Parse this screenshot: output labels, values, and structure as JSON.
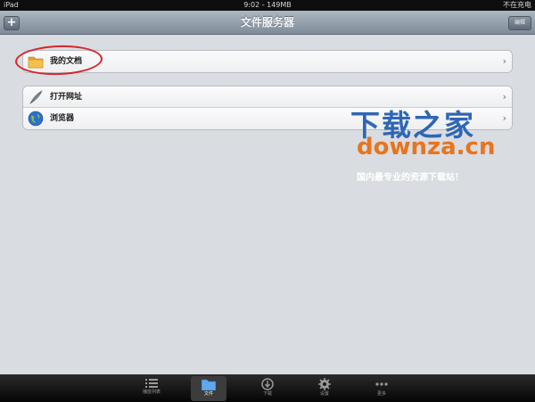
{
  "status_bar": {
    "device": "iPad",
    "time_memory": "9:02 - 149MB",
    "charging": "不在充电"
  },
  "nav": {
    "title": "文件服务器",
    "add_label": "+",
    "edit_label": "编辑"
  },
  "group1": {
    "items": [
      {
        "label": "我的文档",
        "icon": "folder-icon"
      }
    ]
  },
  "group2": {
    "items": [
      {
        "label": "打开网址",
        "icon": "feather-link-icon"
      },
      {
        "label": "浏览器",
        "icon": "globe-icon"
      }
    ]
  },
  "watermark": {
    "title": "下载之家",
    "domain": "downza.cn",
    "tagline": "国内最专业的资源下载站！"
  },
  "tabs": [
    {
      "label": "播放列表",
      "icon": "list-icon",
      "active": false
    },
    {
      "label": "文件",
      "icon": "folder-icon",
      "active": true
    },
    {
      "label": "下载",
      "icon": "download-icon",
      "active": false
    },
    {
      "label": "设置",
      "icon": "gear-icon",
      "active": false
    },
    {
      "label": "更多",
      "icon": "more-icon",
      "active": false
    }
  ],
  "colors": {
    "nav_gradient_top": "#adb7c2",
    "watermark_blue": "#2f66b5",
    "watermark_orange": "#e8741e",
    "annotation_red": "#d4262c"
  }
}
